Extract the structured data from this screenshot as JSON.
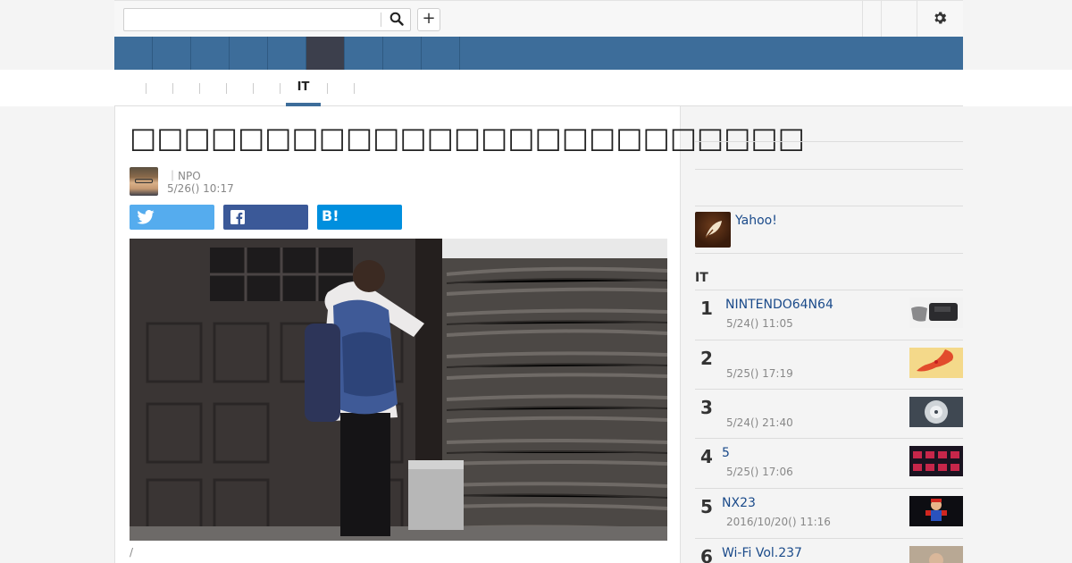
{
  "search": {
    "placeholder": "",
    "add_label": "+"
  },
  "subnav": {
    "active_label": "IT"
  },
  "article": {
    "title": "□□□□□□□□□□□□□□□□□□□□□□□□□",
    "author": "｜NPO",
    "date": "5/26() 10:17",
    "photo_caption": "/",
    "share": {
      "hatena_label": "B!"
    }
  },
  "sidebar": {
    "yahoo_label": "Yahoo!",
    "ranking_title": "IT",
    "items": [
      {
        "rank": "1",
        "title": "NINTENDO64N64",
        "date": "5/24() 11:05",
        "thumb": "console"
      },
      {
        "rank": "2",
        "title": "",
        "date": "5/25() 17:19",
        "thumb": "map"
      },
      {
        "rank": "3",
        "title": "",
        "date": "5/24() 21:40",
        "thumb": "storm"
      },
      {
        "rank": "4",
        "title": "5",
        "date": "5/25() 17:06",
        "thumb": "screens"
      },
      {
        "rank": "5",
        "title": "NX23",
        "date": "2016/10/20() 11:16",
        "thumb": "mario"
      },
      {
        "rank": "6",
        "title": "Wi-Fi  Vol.237",
        "date": "",
        "thumb": "person"
      }
    ]
  },
  "colors": {
    "nav_blue": "#3d6d9a",
    "nav_active": "#3c3f4c",
    "link": "#1a4a8a",
    "twitter": "#55acee",
    "facebook": "#3b5998",
    "hatena": "#008fde"
  }
}
